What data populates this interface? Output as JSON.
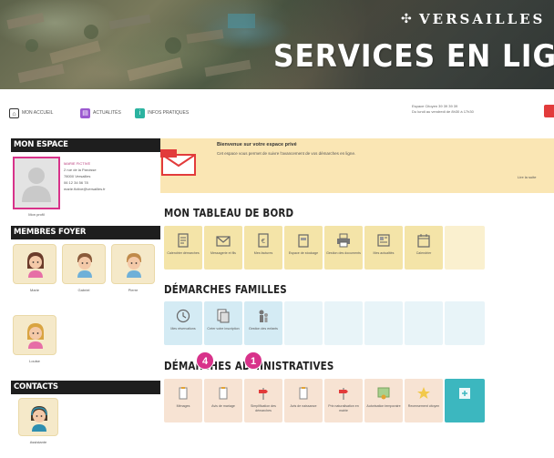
{
  "banner": {
    "brand": "VERSAILLES",
    "title": "SERVICES EN LIGNE"
  },
  "nav": {
    "items": [
      {
        "label": "MON ACCUEIL",
        "color": "#333333"
      },
      {
        "label": "ACTUALITÉS",
        "color": "#9b59d0"
      },
      {
        "label": "INFOS PRATIQUES",
        "color": "#2bb3a0"
      }
    ],
    "info_line1": "Espace Citoyen 39 39 39 39",
    "info_line2": "Du lundi au vendredi de 8h30 à 17h30"
  },
  "sidebar": {
    "mon_espace": "MON ESPACE",
    "profile_label": "Mon profil",
    "profile_lines": [
      "MARIE FICTIVE",
      "2 rue de la Paroisse",
      "78000 Versailles",
      "06 12 34 56 78",
      "marie.fictive@versailles.fr"
    ],
    "membres_foyer": "MEMBRES FOYER",
    "members": [
      {
        "label": "Marie",
        "gender": "girl"
      },
      {
        "label": "Gabriel",
        "gender": "boy"
      },
      {
        "label": "Pierre",
        "gender": "boy"
      },
      {
        "label": "Louise",
        "gender": "girl"
      }
    ],
    "contacts": "CONTACTS",
    "contact_label": "Assistante"
  },
  "alert": {
    "title": "Bienvenue sur votre espace privé",
    "text": "Cet espace vous permet de suivre l'avancement de vos démarches en ligne.",
    "link": "Lire la suite"
  },
  "dashboard": {
    "title": "MON TABLEAU DE BORD",
    "tiles": [
      {
        "label": "Calendrier démarches",
        "icon": "document-icon"
      },
      {
        "label": "Messagerie et fils",
        "icon": "envelope-icon"
      },
      {
        "label": "Mes factures",
        "icon": "invoice-icon"
      },
      {
        "label": "Espace de stockage",
        "icon": "folder-icon"
      },
      {
        "label": "Gestion des documents",
        "icon": "printer-icon"
      },
      {
        "label": "Mes actualités",
        "icon": "newspaper-icon"
      },
      {
        "label": "Calendrier",
        "icon": "calendar-icon"
      }
    ]
  },
  "families": {
    "title": "DÉMARCHES FAMILLES",
    "tiles": [
      {
        "label": "Mes réservations",
        "icon": "clock-icon"
      },
      {
        "label": "Créer votre inscription",
        "icon": "form-icon"
      },
      {
        "label": "Gestion des enfants",
        "icon": "family-icon"
      }
    ]
  },
  "admin": {
    "title": "DÉMARCHES ADMINISTRATIVES",
    "tiles": [
      {
        "label": "Ménages",
        "icon": "clipboard-icon"
      },
      {
        "label": "Avis de mariage",
        "icon": "clipboard-icon"
      },
      {
        "label": "Simplification des démarches",
        "icon": "signpost-icon"
      },
      {
        "label": "Avis de naissance",
        "icon": "clipboard-icon"
      },
      {
        "label": "Prix naturalisation en mairie",
        "icon": "signpost-icon"
      },
      {
        "label": "Autorisation temporaire",
        "icon": "certificate-icon"
      },
      {
        "label": "Recensement citoyen",
        "icon": "star-icon"
      },
      {
        "label": "",
        "icon": "more-icon"
      }
    ]
  },
  "badges": [
    {
      "value": "4"
    },
    {
      "value": "1"
    }
  ],
  "colors": {
    "accent_pink": "#d8328a",
    "alert_bg": "#fae6b4",
    "yellow_tile": "#f4e4a8",
    "blue_tile": "#d4ebf4",
    "pink_tile": "#f7e3d3"
  }
}
